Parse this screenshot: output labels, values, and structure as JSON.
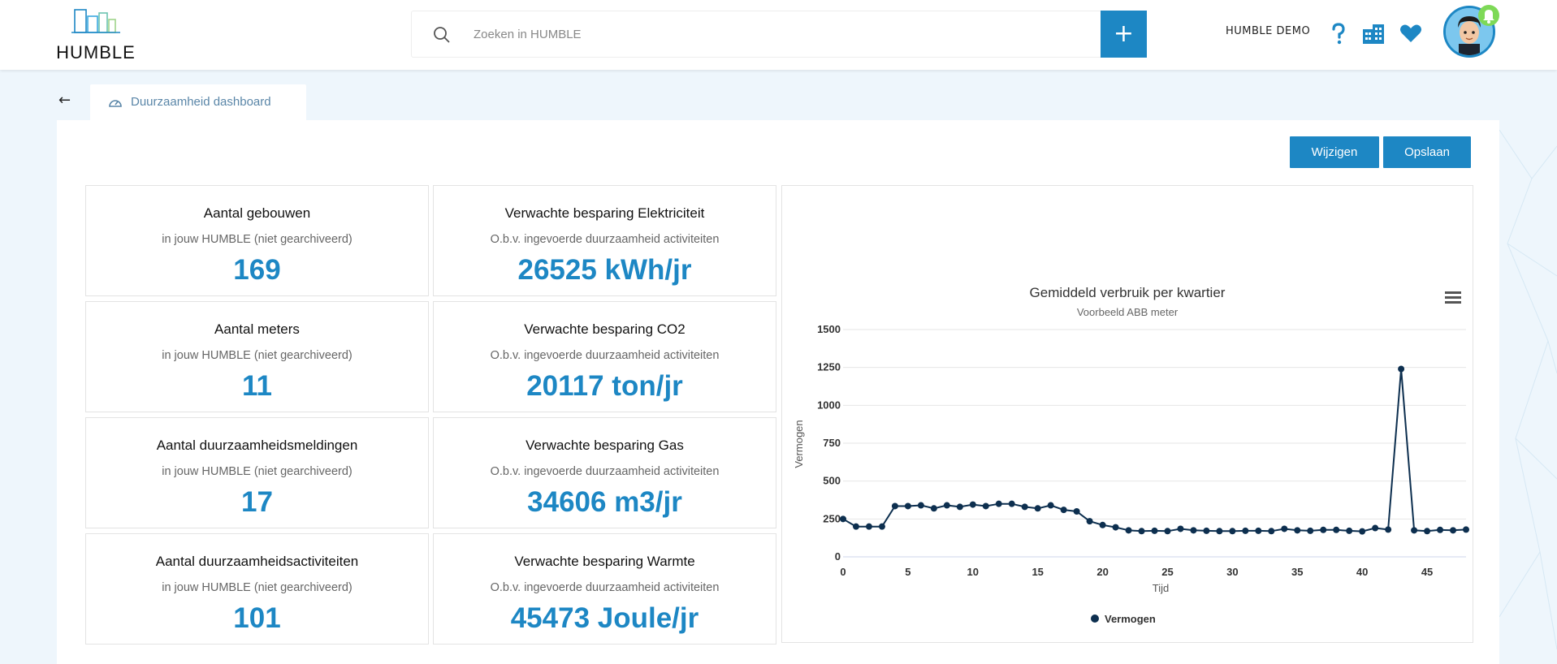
{
  "header": {
    "logo_text": "HUMBLE",
    "search_placeholder": "Zoeken in HUMBLE",
    "add_label": "+",
    "user_name": "HUMBLE DEMO",
    "icons": [
      "search-icon",
      "question-icon",
      "buildings-icon",
      "heart-icon",
      "bell-icon"
    ]
  },
  "tab": {
    "back": "←",
    "label": "Duurzaamheid dashboard"
  },
  "buttons": {
    "edit": "Wijzigen",
    "save": "Opslaan"
  },
  "cards": [
    {
      "title": "Aantal gebouwen",
      "subtitle": "in jouw HUMBLE (niet gearchiveerd)",
      "value": "169"
    },
    {
      "title": "Verwachte besparing Elektriciteit",
      "subtitle": "O.b.v. ingevoerde duurzaamheid activiteiten",
      "value": "26525 kWh/jr"
    },
    {
      "title": "Aantal meters",
      "subtitle": "in jouw HUMBLE (niet gearchiveerd)",
      "value": "11"
    },
    {
      "title": "Verwachte besparing CO2",
      "subtitle": "O.b.v. ingevoerde duurzaamheid activiteiten",
      "value": "20117 ton/jr"
    },
    {
      "title": "Aantal duurzaamheidsmeldingen",
      "subtitle": "in jouw HUMBLE (niet gearchiveerd)",
      "value": "17"
    },
    {
      "title": "Verwachte besparing Gas",
      "subtitle": "O.b.v. ingevoerde duurzaamheid activiteiten",
      "value": "34606 m3/jr"
    },
    {
      "title": "Aantal duurzaamheidsactiviteiten",
      "subtitle": "in jouw HUMBLE (niet gearchiveerd)",
      "value": "101"
    },
    {
      "title": "Verwachte besparing Warmte",
      "subtitle": "O.b.v. ingevoerde duurzaamheid activiteiten",
      "value": "45473 Joule/jr"
    }
  ],
  "colors": {
    "accent": "#1d87c4",
    "line": "#0d2f4f",
    "background": "#eef6fc"
  },
  "chart_data": {
    "type": "line",
    "title": "Gemiddeld verbruik per kwartier",
    "subtitle": "Voorbeeld ABB meter",
    "xlabel": "Tijd",
    "ylabel": "Vermogen",
    "xlim": [
      0,
      48
    ],
    "ylim": [
      0,
      1500
    ],
    "xticks": [
      0,
      5,
      10,
      15,
      20,
      25,
      30,
      35,
      40,
      45
    ],
    "yticks": [
      0,
      250,
      500,
      750,
      1000,
      1250,
      1500
    ],
    "grid": true,
    "legend": "bottom-center",
    "series": [
      {
        "name": "Vermogen",
        "x": [
          0,
          1,
          2,
          3,
          4,
          5,
          6,
          7,
          8,
          9,
          10,
          11,
          12,
          13,
          14,
          15,
          16,
          17,
          18,
          19,
          20,
          21,
          22,
          23,
          24,
          25,
          26,
          27,
          28,
          29,
          30,
          31,
          32,
          33,
          34,
          35,
          36,
          37,
          38,
          39,
          40,
          41,
          42,
          43,
          44,
          45,
          46,
          47,
          48
        ],
        "y": [
          250,
          200,
          200,
          200,
          335,
          335,
          340,
          320,
          340,
          330,
          345,
          335,
          350,
          350,
          330,
          320,
          340,
          310,
          300,
          235,
          210,
          195,
          175,
          170,
          172,
          170,
          185,
          175,
          172,
          170,
          170,
          172,
          172,
          170,
          185,
          175,
          172,
          178,
          178,
          172,
          168,
          190,
          180,
          1240,
          175,
          170,
          178,
          175,
          180
        ]
      }
    ]
  }
}
